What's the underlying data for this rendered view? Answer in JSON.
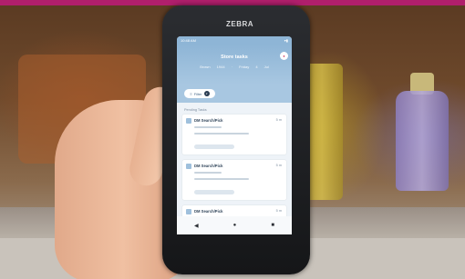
{
  "device": {
    "brand": "ZEBRA"
  },
  "app": {
    "status_left": "10:48 AM",
    "title": "Store tasks",
    "subtitle": "Brown 1944 · Friday 4 Jul",
    "avatar_icon": "avatar-icon",
    "filter": {
      "label": "Filter",
      "count": "2"
    },
    "section_label": "Pending Tasks",
    "cards": [
      {
        "title": "DM Search/Pick",
        "time": "5 m"
      },
      {
        "title": "DM Search/Pick",
        "time": "5 m"
      },
      {
        "title": "DM Search/Pick",
        "time": "5 m"
      }
    ],
    "nav": {
      "back": "◀",
      "home": "●",
      "recent": "■"
    }
  },
  "colors": {
    "accent": "#8eb5d6",
    "strip": "#b01f6c"
  }
}
